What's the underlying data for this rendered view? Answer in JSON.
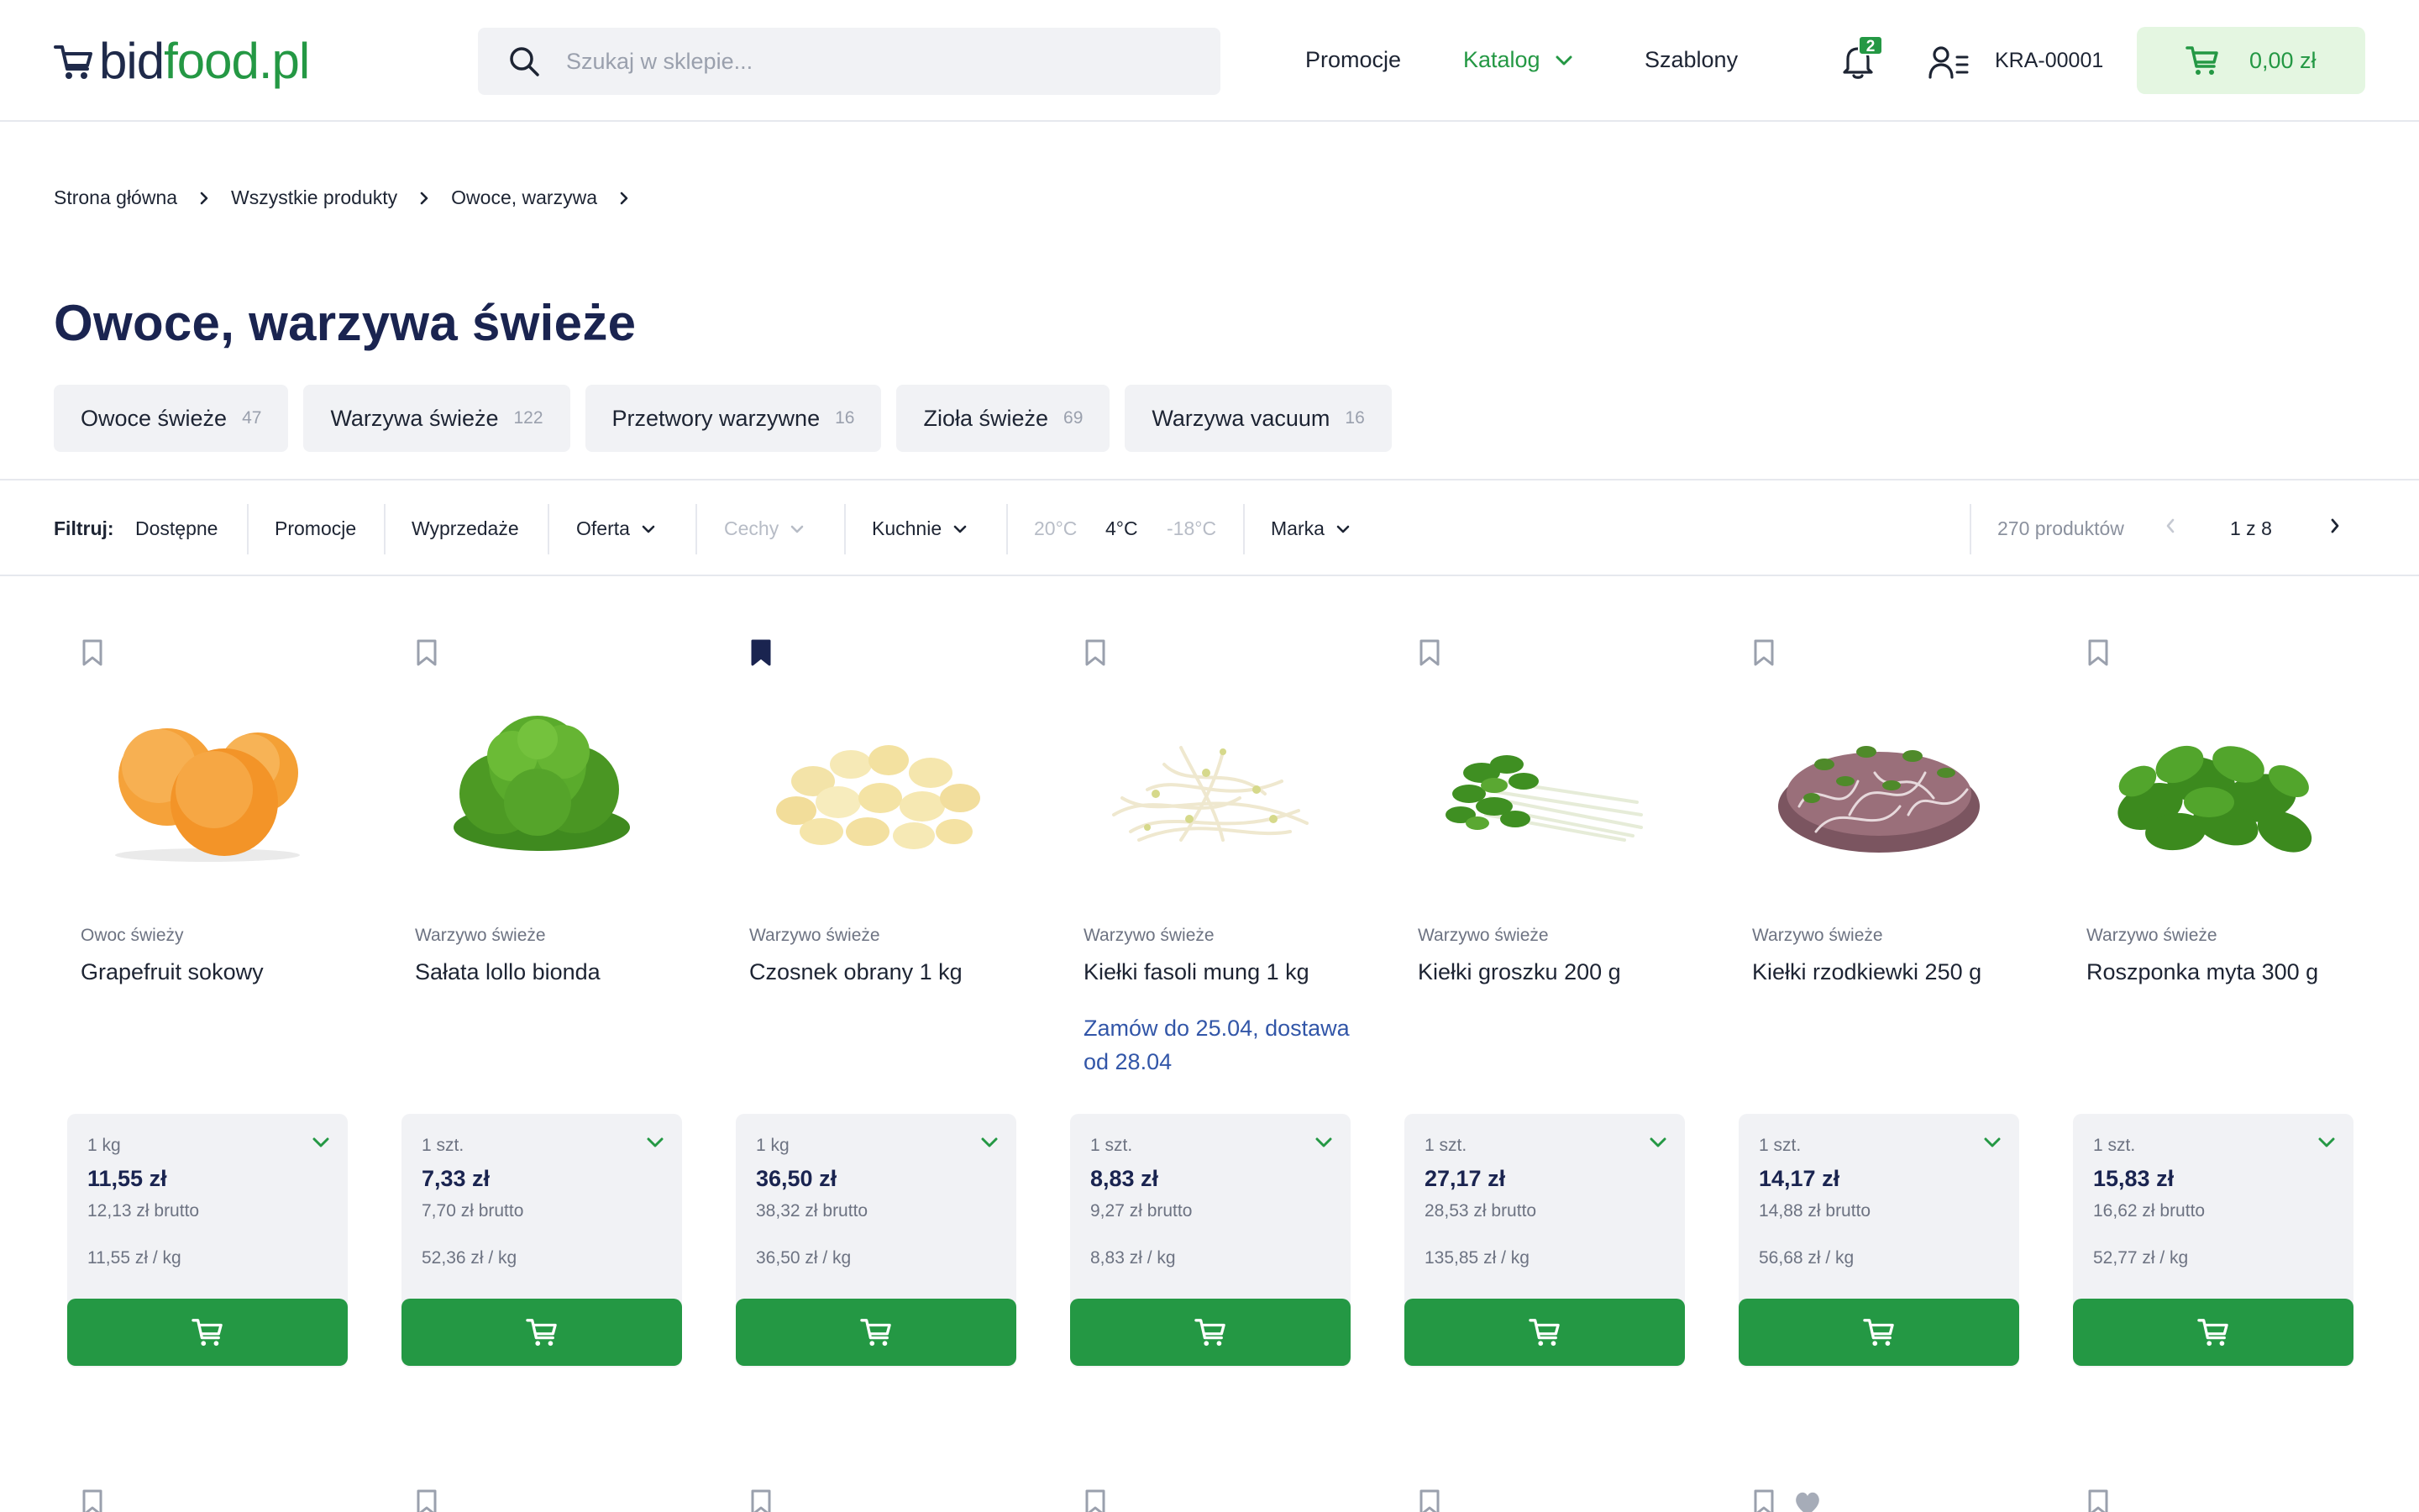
{
  "header": {
    "logo": {
      "part1": "bid",
      "part2": "food",
      "part3": ".pl"
    },
    "search_placeholder": "Szukaj w sklepie...",
    "nav": {
      "promocje": "Promocje",
      "katalog": "Katalog",
      "szablony": "Szablony"
    },
    "notifications_count": "2",
    "account_code": "KRA-00001",
    "cart_total": "0,00 zł"
  },
  "breadcrumb": [
    "Strona główna",
    "Wszystkie produkty",
    "Owoce, warzywa"
  ],
  "page_title": "Owoce, warzywa świeże",
  "categories": [
    {
      "label": "Owoce świeże",
      "count": "47"
    },
    {
      "label": "Warzywa świeże",
      "count": "122"
    },
    {
      "label": "Przetwory warzywne",
      "count": "16"
    },
    {
      "label": "Zioła świeże",
      "count": "69"
    },
    {
      "label": "Warzywa vacuum",
      "count": "16"
    }
  ],
  "filters": {
    "label": "Filtruj:",
    "available": "Dostępne",
    "promotions": "Promocje",
    "sales": "Wyprzedaże",
    "offer": "Oferta",
    "features": "Cechy",
    "kitchens": "Kuchnie",
    "temp_20": "20°C",
    "temp_4": "4°C",
    "temp_minus18": "-18°C",
    "brand": "Marka"
  },
  "pager": {
    "product_count": "270 produktów",
    "page": "1 z 8"
  },
  "colors": {
    "green": "#249844",
    "navy": "#1a2450",
    "link_blue": "#3256a8",
    "cart_bg": "#e4f6e1"
  },
  "products": [
    {
      "category": "Owoc świeży",
      "name": "Grapefruit sokowy",
      "note": "",
      "unit": "1 kg",
      "price_net": "11,55 zł",
      "price_gross": "12,13 zł brutto",
      "price_per": "11,55 zł / kg",
      "bookmarked": false,
      "image": "grapefruit"
    },
    {
      "category": "Warzywo świeże",
      "name": "Sałata lollo bionda",
      "note": "",
      "unit": "1 szt.",
      "price_net": "7,33 zł",
      "price_gross": "7,70 zł brutto",
      "price_per": "52,36 zł / kg",
      "bookmarked": false,
      "image": "lettuce"
    },
    {
      "category": "Warzywo świeże",
      "name": "Czosnek obrany 1 kg",
      "note": "",
      "unit": "1 kg",
      "price_net": "36,50 zł",
      "price_gross": "38,32 zł brutto",
      "price_per": "36,50 zł / kg",
      "bookmarked": true,
      "image": "garlic"
    },
    {
      "category": "Warzywo świeże",
      "name": "Kiełki fasoli mung 1 kg",
      "note": "Zamów do 25.04, dostawa od 28.04",
      "unit": "1 szt.",
      "price_net": "8,83 zł",
      "price_gross": "9,27 zł brutto",
      "price_per": "8,83 zł / kg",
      "bookmarked": false,
      "image": "mung-sprouts"
    },
    {
      "category": "Warzywo świeże",
      "name": "Kiełki groszku 200 g",
      "note": "",
      "unit": "1 szt.",
      "price_net": "27,17 zł",
      "price_gross": "28,53 zł brutto",
      "price_per": "135,85 zł / kg",
      "bookmarked": false,
      "image": "pea-sprouts"
    },
    {
      "category": "Warzywo świeże",
      "name": "Kiełki rzodkiewki 250 g",
      "note": "",
      "unit": "1 szt.",
      "price_net": "14,17 zł",
      "price_gross": "14,88 zł brutto",
      "price_per": "56,68 zł / kg",
      "bookmarked": false,
      "image": "radish-sprouts"
    },
    {
      "category": "Warzywo świeże",
      "name": "Roszponka myta 300 g",
      "note": "",
      "unit": "1 szt.",
      "price_net": "15,83 zł",
      "price_gross": "16,62 zł brutto",
      "price_per": "52,77 zł / kg",
      "bookmarked": false,
      "image": "lambs-lettuce"
    }
  ]
}
